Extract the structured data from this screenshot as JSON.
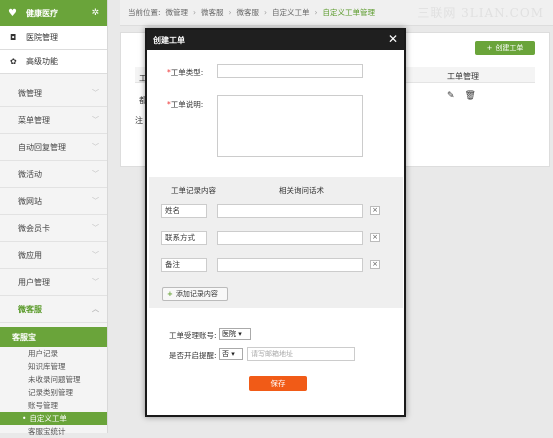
{
  "sidebar": {
    "brand": "健康医疗",
    "top_items": [
      {
        "icon": "camera-icon",
        "label": "医院管理"
      },
      {
        "icon": "gear-icon",
        "label": "高级功能"
      }
    ],
    "nav": [
      "微管理",
      "菜单管理",
      "自动回复管理",
      "微活动",
      "微网站",
      "微会员卡",
      "微应用",
      "用户管理",
      "微客服"
    ],
    "section": "客服宝",
    "sub_items": [
      "用户记录",
      "知识库管理",
      "未收录问题管理",
      "记录类别管理",
      "账号管理",
      "自定义工单",
      "客服宝统计"
    ]
  },
  "breadcrumb": {
    "prefix": "当前位置:",
    "items": [
      "微管理",
      "微客服",
      "微客服",
      "自定义工单",
      "自定义工单管理"
    ]
  },
  "watermark": "三联网 3LIAN.COM",
  "panel": {
    "create_button": "创建工单",
    "column_header": "工单管理",
    "stub1": "工",
    "stub2": "都",
    "note_stub": "注"
  },
  "modal": {
    "title": "创建工单",
    "type_label": "工单类型:",
    "desc_label": "工单说明:",
    "record_header": "工单记录内容",
    "script_header": "相关询问话术",
    "records": [
      "姓名",
      "联系方式",
      "备注"
    ],
    "add_button": "添加记录内容",
    "account_label": "工单受理账号:",
    "account_value": "医院",
    "remind_label": "是否开启提醒:",
    "remind_value": "否",
    "email_placeholder": "请写邮箱地址",
    "save_button": "保存"
  }
}
